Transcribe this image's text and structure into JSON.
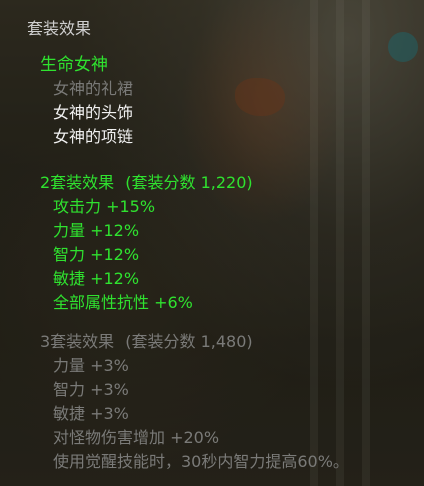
{
  "tooltip": {
    "header": "套装效果",
    "set_name": "生命女神",
    "pieces": [
      {
        "name": "女神的礼裙",
        "equipped": false
      },
      {
        "name": "女神的头饰",
        "equipped": true
      },
      {
        "name": "女神的项链",
        "equipped": true
      }
    ],
    "tier2": {
      "title": "2套装效果",
      "score": "(套装分数 1,220)",
      "active": true,
      "stats": [
        "攻击力 +15%",
        "力量 +12%",
        "智力 +12%",
        "敏捷 +12%",
        "全部属性抗性 +6%"
      ]
    },
    "tier3": {
      "title": "3套装效果",
      "score": "(套装分数 1,480)",
      "active": false,
      "stats": [
        "力量 +3%",
        "智力 +3%",
        "敏捷 +3%",
        "对怪物伤害增加 +20%",
        "使用觉醒技能时，30秒内智力提高60%。"
      ]
    }
  },
  "colors": {
    "active": "#2fe22f",
    "inactive": "#7a7a78",
    "equipped": "#f1f1f1",
    "header": "#cfcfcf"
  }
}
